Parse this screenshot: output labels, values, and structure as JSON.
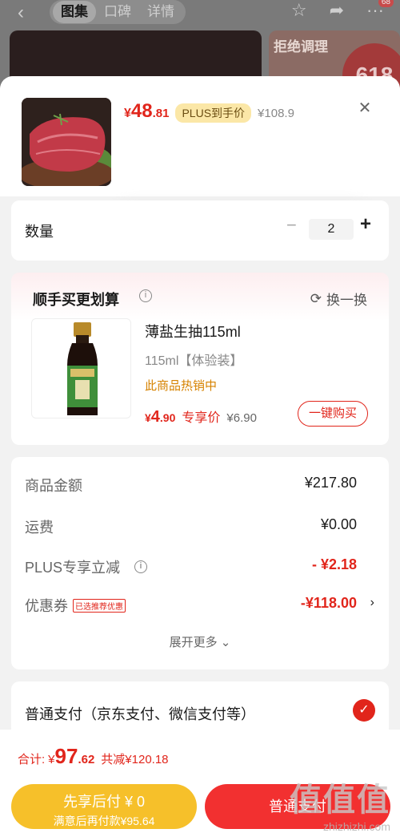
{
  "background": {
    "tabs": [
      "图集",
      "口碑",
      "详情"
    ],
    "active_tab": "图集",
    "badge": "68",
    "banner_text": "拒绝调理",
    "banner_number": "618"
  },
  "product": {
    "price_yen": "¥",
    "price_int": "48",
    "price_dec": ".81",
    "plus_tag": "PLUS到手价",
    "orig_price": "¥108.9"
  },
  "quantity": {
    "label": "数量",
    "value": "2",
    "minus": "−",
    "plus": "+"
  },
  "addon": {
    "title": "顺手买更划算",
    "swap_label": "换一换",
    "name": "薄盐生抽115ml",
    "spec": "115ml【体验装】",
    "hot": "此商品热销中",
    "price_yen": "¥",
    "price_int": "4",
    "price_dec": ".90",
    "price_label": "专享价",
    "orig_price": "¥6.90",
    "buy_label": "一键购买"
  },
  "summary": {
    "rows": [
      {
        "k": "商品金额",
        "v": "¥217.80"
      },
      {
        "k": "运费",
        "v": "¥0.00"
      },
      {
        "k": "PLUS专享立减",
        "v": "- ¥2.18"
      },
      {
        "k": "优惠券",
        "tag": "已选推荐优惠",
        "v": "-¥118.00"
      }
    ],
    "expand": "展开更多"
  },
  "payment": {
    "label": "普通支付（京东支付、微信支付等）"
  },
  "footer": {
    "total_label": "合计:",
    "total_yen": "¥",
    "total_int": "97",
    "total_dec": ".62",
    "save": "共减¥120.18",
    "later_l1": "先享后付 ¥ 0",
    "later_l2": "满意后再付款¥95.64",
    "pay_label": "普通支付"
  },
  "watermark": {
    "big": "值值值",
    "small": "zhizhizhi.com"
  },
  "colors": {
    "accent": "#e1251b",
    "later": "#f6c02a",
    "pay": "#f23030"
  }
}
